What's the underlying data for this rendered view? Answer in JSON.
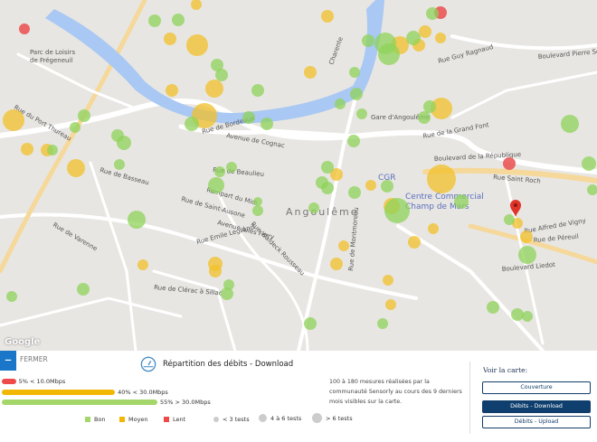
{
  "map": {
    "attribution": "Google",
    "city_label": "Angoulême",
    "poi_labels": [
      "CGR",
      "Centre Commercial",
      "Champ de Mars",
      "Gare d'Angoulême",
      "Parc de Loisirs",
      "de Frégeneuil"
    ],
    "street_labels": [
      "Rue de Bordeaux",
      "Avenue de Cognac",
      "Rue de Beaulieu",
      "Rempart du Midi",
      "Rue de Saint-Ausone",
      "Avenue Jules Ferry",
      "Rue Waldeck Rousseau",
      "Rue Emile Legrand",
      "Boulevard de la République",
      "Rue de la Grand Font",
      "Boulevard Liedot",
      "Rue de Péreuil",
      "Rue Alfred de Vigny",
      "Rue de Varenne",
      "Rue de Clérac à Sillac",
      "Charente",
      "Boulevard Pierre Semard",
      "Rue Guy Ragnaud",
      "Rue du Port Thureau",
      "Rue de Basseau",
      "Rue Saint Roch",
      "Rue de Montmoreau"
    ],
    "colors": {
      "bon": "#8fd35a",
      "moyen": "#f2c02a",
      "lent": "#ea4d4d",
      "river": "#a9c8f3",
      "road": "#ffffff",
      "boulevard": "#f5d89a"
    }
  },
  "panel": {
    "close_label": "FERMER",
    "title": "Répartition des débits - Download",
    "distribution": [
      {
        "label": "5% < 10.0Mbps",
        "percent": 5,
        "color": "#ef4a4a"
      },
      {
        "label": "40% < 30.0Mbps",
        "percent": 40,
        "color": "#f2b705"
      },
      {
        "label": "55% > 30.0Mbps",
        "percent": 55,
        "color": "#a5d66a"
      }
    ],
    "legend": {
      "bon": "Bon",
      "moyen": "Moyen",
      "lent": "Lent",
      "small": "< 3 tests",
      "medium": "4 à 6 tests",
      "large": "> 6 tests"
    },
    "description": "100 à 180 mesures réalisées par la communauté Sensorly au cours des 9 derniers mois visibles sur la carte.",
    "voir_title": "Voir la carte:",
    "buttons": [
      "Couverture",
      "Débits - Download",
      "Débits - Upload"
    ]
  }
}
